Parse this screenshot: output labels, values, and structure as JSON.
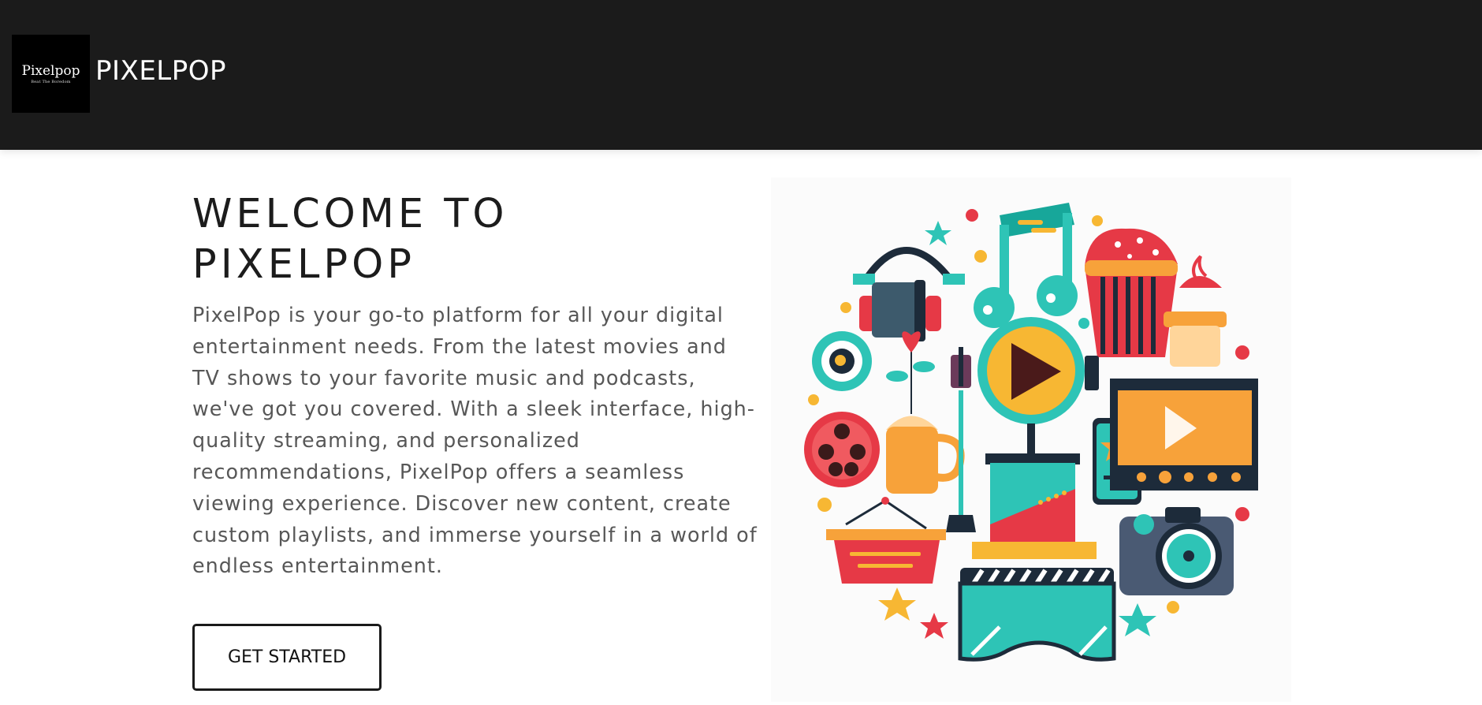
{
  "header": {
    "logo_name": "Pixelpop",
    "logo_tagline": "Beat The Boredom",
    "brand": "PIXELPOP"
  },
  "hero": {
    "title": "WELCOME TO PIXELPOP",
    "description": "PixelPop is your go-to platform for all your digital entertainment needs. From the latest movies and TV shows to your favorite music and podcasts, we've got you covered. With a sleek interface, high-quality streaming, and personalized recommendations, PixelPop offers a seamless viewing experience. Discover new content, create custom playlists, and immerse yourself in a world of endless entertainment.",
    "cta_label": "GET STARTED"
  },
  "colors": {
    "header_bg": "#1b1b1b",
    "teal": "#2ec4b6",
    "red": "#e63946",
    "orange": "#f7a23a",
    "navy": "#1d2b3a"
  }
}
